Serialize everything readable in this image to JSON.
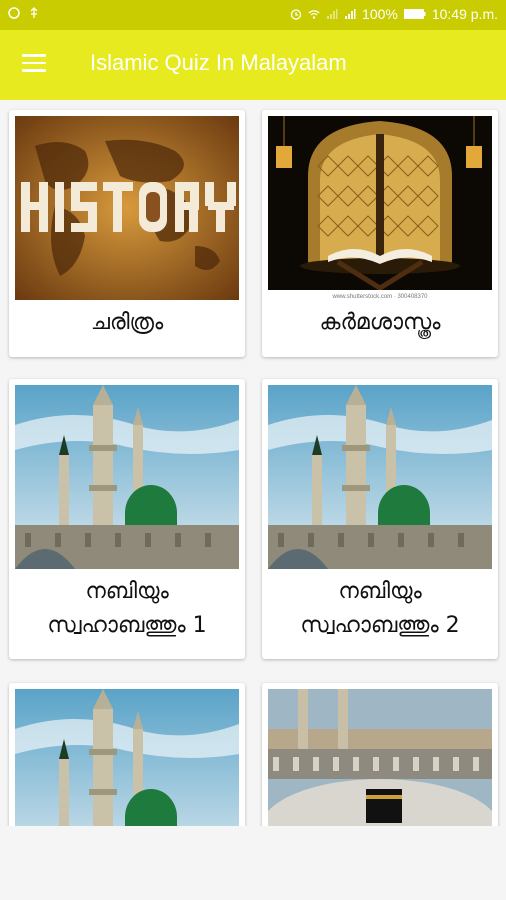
{
  "status_bar": {
    "battery": "100%",
    "time": "10:49 p.m."
  },
  "app_bar": {
    "title": "Islamic Quiz In Malayalam"
  },
  "cards": [
    {
      "label": "ചരിത്രം",
      "image": "history-world-map-image"
    },
    {
      "label": "കർമശാസ്ത്രം",
      "image": "quran-on-stand-image"
    },
    {
      "label": "നബിയും\nസ്വഹാബത്തും 1",
      "image": "green-dome-mosque-image"
    },
    {
      "label": "നബിയും\nസ്വഹാബത്തും 2",
      "image": "green-dome-mosque-image"
    },
    {
      "label": "",
      "image": "green-dome-mosque-image"
    },
    {
      "label": "",
      "image": "kaaba-mecca-image"
    }
  ],
  "image_watermark": "www.shutterstock.com · 300408370",
  "colors": {
    "status_bar": "#c9cc00",
    "app_bar": "#e6ea1f"
  }
}
